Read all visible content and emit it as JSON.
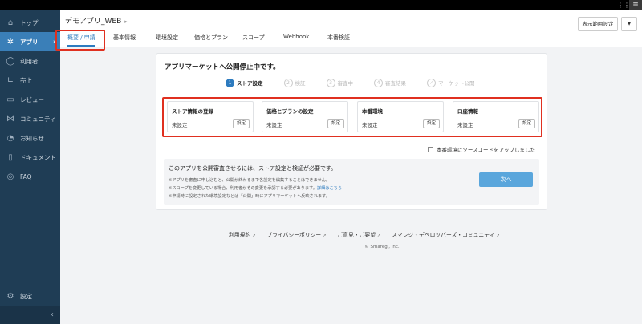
{
  "topbar": {
    "grid_icon": "grid-icon",
    "menu_icon": "hamburger-icon"
  },
  "sidebar": {
    "items": [
      {
        "label": "トップ",
        "icon": "home-icon"
      },
      {
        "label": "アプリ",
        "icon": "puzzle-icon",
        "active": true
      },
      {
        "label": "利用者",
        "icon": "user-icon"
      },
      {
        "label": "売上",
        "icon": "chart-icon"
      },
      {
        "label": "レビュー",
        "icon": "review-icon"
      },
      {
        "label": "コミュニティ",
        "icon": "community-icon"
      },
      {
        "label": "お知らせ",
        "icon": "bell-icon"
      },
      {
        "label": "ドキュメント",
        "icon": "document-icon"
      },
      {
        "label": "FAQ",
        "icon": "faq-icon"
      }
    ],
    "settings_label": "設定",
    "collapse_glyph": "‹"
  },
  "header": {
    "app_name": "デモアプリ_WEB",
    "scope_button": "表示範囲設定",
    "tabs": [
      "概要 / 申請",
      "基本情報",
      "環境設定",
      "価格とプラン",
      "スコープ",
      "Webhook",
      "本番検証"
    ]
  },
  "card": {
    "title": "アプリマーケットへ公開停止中です。",
    "steps": [
      {
        "num": "1",
        "label": "ストア設定",
        "active": true
      },
      {
        "num": "2",
        "label": "検証"
      },
      {
        "num": "3",
        "label": "審査中"
      },
      {
        "num": "4",
        "label": "審査結果"
      },
      {
        "num": "✓",
        "label": "マーケット公開"
      }
    ],
    "settings": [
      {
        "title": "ストア情報の登録",
        "status": "未設定",
        "button": "設定"
      },
      {
        "title": "価格とプランの設定",
        "status": "未設定",
        "button": "設定"
      },
      {
        "title": "本番環境",
        "status": "未設定",
        "button": "設定"
      },
      {
        "title": "口座情報",
        "status": "未設定",
        "button": "設定"
      }
    ],
    "source_checkbox_label": "本番環境にソースコードをアップしました",
    "notice": {
      "main": "このアプリを公開審査させるには、ストア設定と検証が必要です。",
      "note1": "※アプリを審査に申し込むと、公開が終わるまで各設定を編集することはできません。",
      "note2": "※スコープを変更している場合、利用者がその変更を承認する必要があります。",
      "note2_link": "詳細はこちら",
      "note3": "※申請時に設定された環境設定などは「公開」時にアプリマーケットへ反映されます。"
    },
    "next_button": "次へ"
  },
  "footer": {
    "links": [
      "利用規約",
      "プライバシーポリシー",
      "ご意見・ご要望",
      "スマレジ・デベロッパーズ・コミュニティ"
    ],
    "copyright": "© Smaregi, Inc."
  }
}
